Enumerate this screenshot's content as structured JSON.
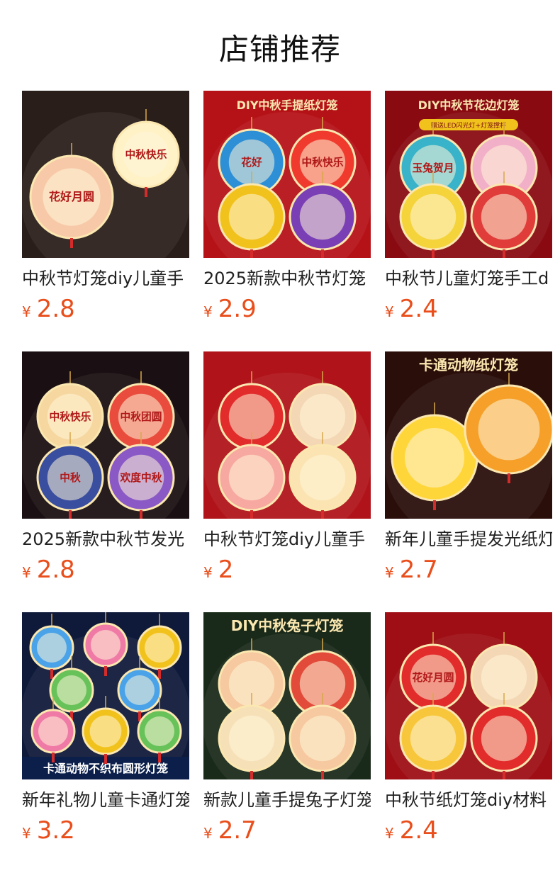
{
  "page": {
    "title": "店铺推荐",
    "currency_symbol": "¥"
  },
  "products": [
    {
      "title": "中秋节灯笼diy儿童手",
      "price": "2.8",
      "image_text": "",
      "lantern_labels": [
        "花好月圆",
        "中秋快乐"
      ],
      "bg": "#2a1e1a",
      "palette": [
        "#f7c9a8",
        "#fff2c7",
        "#d9453b"
      ]
    },
    {
      "title": "2025新款中秋节灯笼",
      "price": "2.9",
      "image_text": "DIY中秋手提纸灯笼",
      "lantern_labels": [
        "花好",
        "中秋快乐"
      ],
      "bg": "#b51218",
      "palette": [
        "#2d8fd6",
        "#f03a2d",
        "#f2c21c",
        "#7a3fb5"
      ]
    },
    {
      "title": "中秋节儿童灯笼手工d",
      "price": "2.4",
      "image_text": "DIY中秋节花边灯笼",
      "image_subtext": "赠送LED闪光灯+灯笼撑杆",
      "lantern_labels": [
        "玉兔贺月"
      ],
      "bg": "#8a0a12",
      "palette": [
        "#38b3c9",
        "#f2b0c8",
        "#f5d33a",
        "#e03c3a"
      ]
    },
    {
      "title": "2025新款中秋节发光",
      "price": "2.8",
      "image_text": "",
      "lantern_labels": [
        "中秋快乐",
        "中秋团圆",
        "中秋",
        "欢度中秋"
      ],
      "bg": "#1a0f12",
      "palette": [
        "#f6d7a0",
        "#e94b3c",
        "#3a4ea0",
        "#8a59c5"
      ]
    },
    {
      "title": "中秋节灯笼diy儿童手",
      "price": "2",
      "image_text": "",
      "lantern_labels": [],
      "bg": "#b0141a",
      "palette": [
        "#e22b2b",
        "#f4d7b4",
        "#f7a8a0",
        "#fbe4b2"
      ]
    },
    {
      "title": "新年儿童手提发光纸灯",
      "price": "2.7",
      "image_text": "卡通动物纸灯笼",
      "lantern_labels": [],
      "bg": "#2a0e0a",
      "palette": [
        "#ffd63a",
        "#f6a02a",
        "#3a2a1a"
      ]
    },
    {
      "title": "新年礼物儿童卡通灯笼",
      "price": "3.2",
      "image_text": "卡通动物不织布圆形灯笼",
      "lantern_labels": [],
      "bg": "#0f1a3a",
      "palette": [
        "#4aa3e8",
        "#f07aa6",
        "#f2c21c",
        "#67c25a"
      ]
    },
    {
      "title": "新款儿童手提兔子灯笼",
      "price": "2.7",
      "image_text": "DIY中秋兔子灯笼",
      "lantern_labels": [],
      "bg": "#1a2a1a",
      "palette": [
        "#f6c9a0",
        "#e24a3a",
        "#f6e0b8"
      ]
    },
    {
      "title": "中秋节纸灯笼diy材料",
      "price": "2.4",
      "image_text": "",
      "lantern_labels": [
        "花好月圆"
      ],
      "bg": "#9e0e14",
      "palette": [
        "#e22b2b",
        "#f4d7b4",
        "#f7c63a"
      ]
    }
  ]
}
